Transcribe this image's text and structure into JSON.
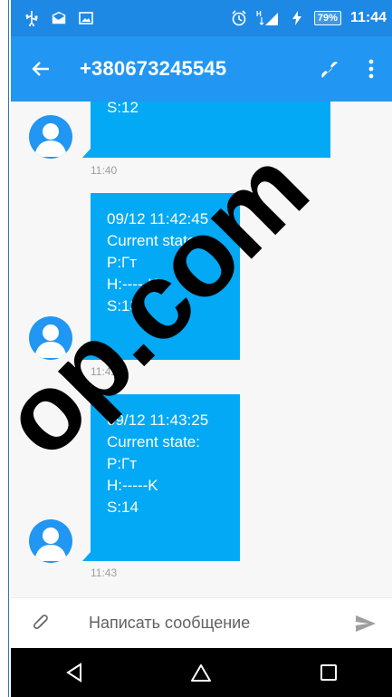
{
  "status_bar": {
    "battery": "79%",
    "time": "11:44",
    "network": "H"
  },
  "app_bar": {
    "title": "+380673245545",
    "icons": [
      "back-arrow-icon",
      "phone-icon",
      "more-vert-icon"
    ]
  },
  "messages": [
    {
      "lines": [
        "S:12"
      ],
      "time": "11:40"
    },
    {
      "lines": [
        "09/12 11:42:45",
        "Current state:",
        "P:Гт",
        "H:-----K",
        "S:13"
      ],
      "time": "11:42"
    },
    {
      "lines": [
        "09/12 11:43:25",
        "Current state:",
        "P:Гт",
        "H:-----K",
        "S:14"
      ],
      "time": "11:43"
    }
  ],
  "compose": {
    "placeholder": "Написать сообщение"
  },
  "watermark": "...op.com",
  "colors": {
    "status_bar": "#1e88e5",
    "app_bar": "#2196f3",
    "bubble": "#03a9f4",
    "nav_bar": "#000000"
  }
}
